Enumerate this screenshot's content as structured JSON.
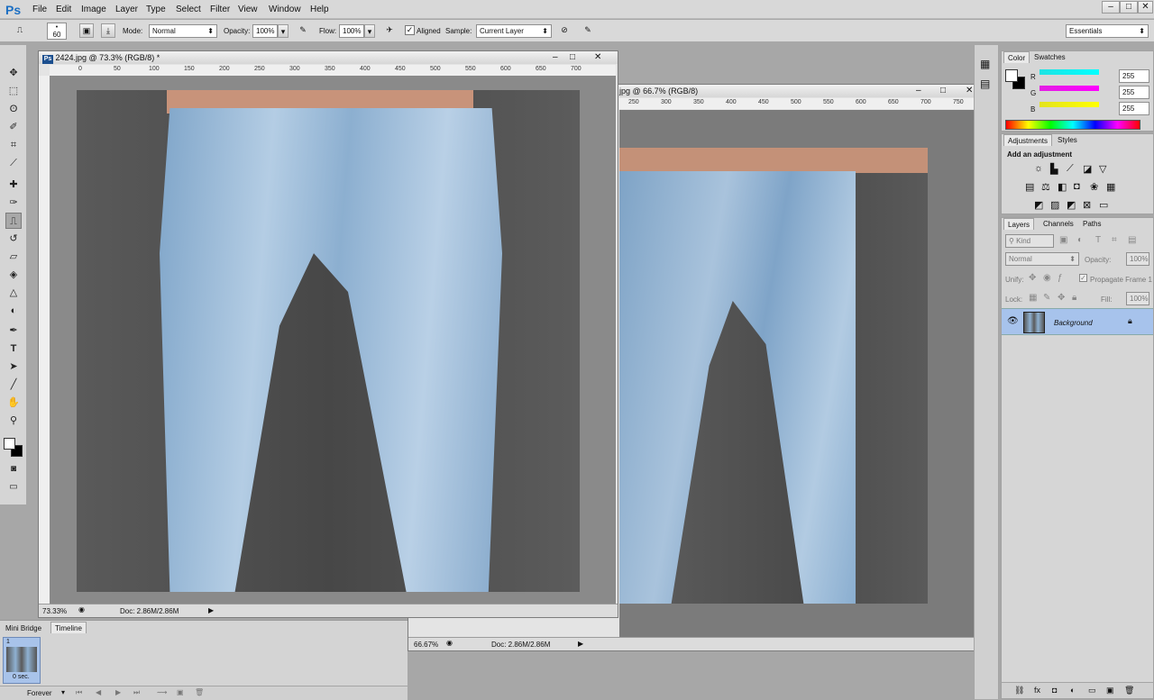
{
  "app": {
    "logo": "Ps"
  },
  "menu": [
    "File",
    "Edit",
    "Image",
    "Layer",
    "Type",
    "Select",
    "Filter",
    "View",
    "Window",
    "Help"
  ],
  "window_controls": {
    "minimize": "–",
    "maximize": "□",
    "close": "✕"
  },
  "options": {
    "brush_size": "60",
    "mode_label": "Mode:",
    "mode_value": "Normal",
    "opacity_label": "Opacity:",
    "opacity_value": "100%",
    "flow_label": "Flow:",
    "flow_value": "100%",
    "aligned_label": "Aligned",
    "sample_label": "Sample:",
    "sample_value": "Current Layer",
    "workspace": "Essentials"
  },
  "tools": [
    "move-tool-icon",
    "marquee-tool-icon",
    "lasso-tool-icon",
    "quick-select-icon",
    "crop-tool-icon",
    "eyedropper-icon",
    "healing-brush-icon",
    "brush-tool-icon",
    "clone-stamp-icon",
    "history-brush-icon",
    "eraser-icon",
    "paint-bucket-icon",
    "blur-tool-icon",
    "dodge-tool-icon",
    "pen-tool-icon",
    "type-tool-icon",
    "path-select-icon",
    "line-tool-icon",
    "hand-tool-icon",
    "zoom-tool-icon"
  ],
  "doc1": {
    "title": "2424.jpg @ 73.3% (RGB/8) *",
    "ruler_ticks": [
      "0",
      "50",
      "100",
      "150",
      "200",
      "250",
      "300",
      "350",
      "400",
      "450",
      "500",
      "550",
      "600",
      "650",
      "700"
    ],
    "zoom": "73.33%",
    "doc_size": "Doc: 2.86M/2.86M"
  },
  "doc2": {
    "title": "jpg @ 66.7% (RGB/8)",
    "ruler_ticks": [
      "250",
      "300",
      "350",
      "400",
      "450",
      "500",
      "550",
      "600",
      "650",
      "700",
      "750"
    ],
    "zoom": "66.67%",
    "doc_size": "Doc: 2.86M/2.86M"
  },
  "color_panel": {
    "tabs": [
      "Color",
      "Swatches"
    ],
    "channels": [
      {
        "label": "R",
        "value": "255",
        "color": "#00e5e5"
      },
      {
        "label": "G",
        "value": "255",
        "color": "#e500e5"
      },
      {
        "label": "B",
        "value": "255",
        "color": "#e5e500"
      }
    ]
  },
  "adjustments_panel": {
    "tabs": [
      "Adjustments",
      "Styles"
    ],
    "heading": "Add an adjustment"
  },
  "layers_panel": {
    "tabs": [
      "Layers",
      "Channels",
      "Paths"
    ],
    "kind": "Kind",
    "blend": "Normal",
    "opacity_label": "Opacity:",
    "opacity_value": "100%",
    "unify_label": "Unify:",
    "propagate_label": "Propagate Frame 1",
    "lock_label": "Lock:",
    "fill_label": "Fill:",
    "fill_value": "100%",
    "layer_name": "Background"
  },
  "bottom_panel": {
    "tabs": [
      "Mini Bridge",
      "Timeline"
    ],
    "frame_number": "1",
    "frame_delay": "0 sec.",
    "loop": "Forever"
  }
}
